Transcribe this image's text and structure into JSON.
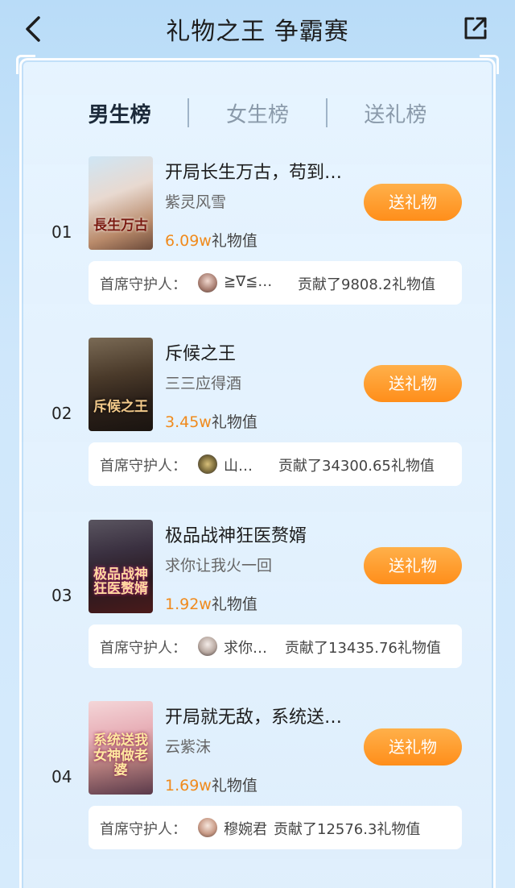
{
  "header": {
    "title": "礼物之王 争霸赛"
  },
  "tabs": [
    {
      "label": "男生榜"
    },
    {
      "label": "女生榜"
    },
    {
      "label": "送礼榜"
    }
  ],
  "guard_label": "首席守护人：",
  "send_label": "送礼物",
  "gift_suffix": "礼物值",
  "entries": [
    {
      "rank": "01",
      "title": "开局长生万古，苟到…",
      "author": "紫灵风雪",
      "gift_value": "6.09w",
      "cover_text": "長生万古",
      "guard_name": "≧∇≦…",
      "contribution": "贡献了9808.2礼物值"
    },
    {
      "rank": "02",
      "title": "斥候之王",
      "author": "三三应得酒",
      "gift_value": "3.45w",
      "cover_text": "斥候之王",
      "guard_name": "山…",
      "contribution": "贡献了34300.65礼物值"
    },
    {
      "rank": "03",
      "title": "极品战神狂医赘婿",
      "author": "求你让我火一回",
      "gift_value": "1.92w",
      "cover_text": "极品战神 狂医赘婿",
      "guard_name": "求你…",
      "contribution": "贡献了13435.76礼物值"
    },
    {
      "rank": "04",
      "title": "开局就无敌，系统送…",
      "author": "云紫沫",
      "gift_value": "1.69w",
      "cover_text": "系统送我 女神做老婆",
      "guard_name": "穆婉君",
      "contribution": "贡献了12576.3礼物值"
    }
  ],
  "colors": {
    "accent_orange": "#ff8e1a",
    "gift_value": "#f08a1c",
    "active_tab": "#1c2a3a"
  }
}
